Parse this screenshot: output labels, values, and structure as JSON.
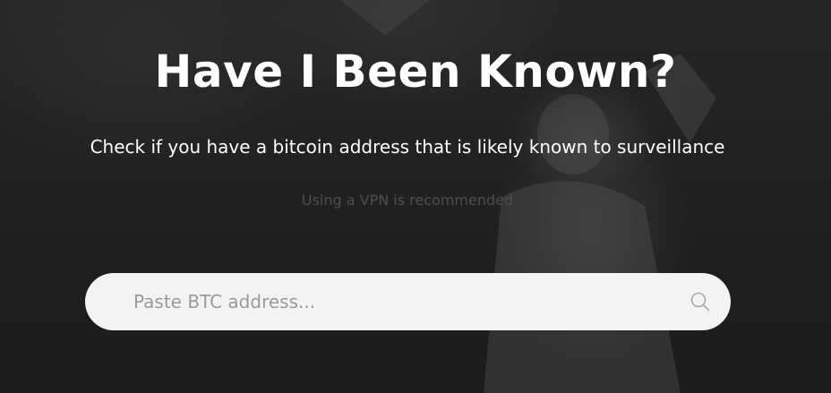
{
  "hero": {
    "title": "Have I Been Known?",
    "subtitle": "Check if you have a bitcoin address that is likely known to surveillance",
    "note": "Using a VPN is recommended"
  },
  "search": {
    "placeholder": "Paste BTC address...",
    "value": "",
    "icon": "search-icon"
  }
}
